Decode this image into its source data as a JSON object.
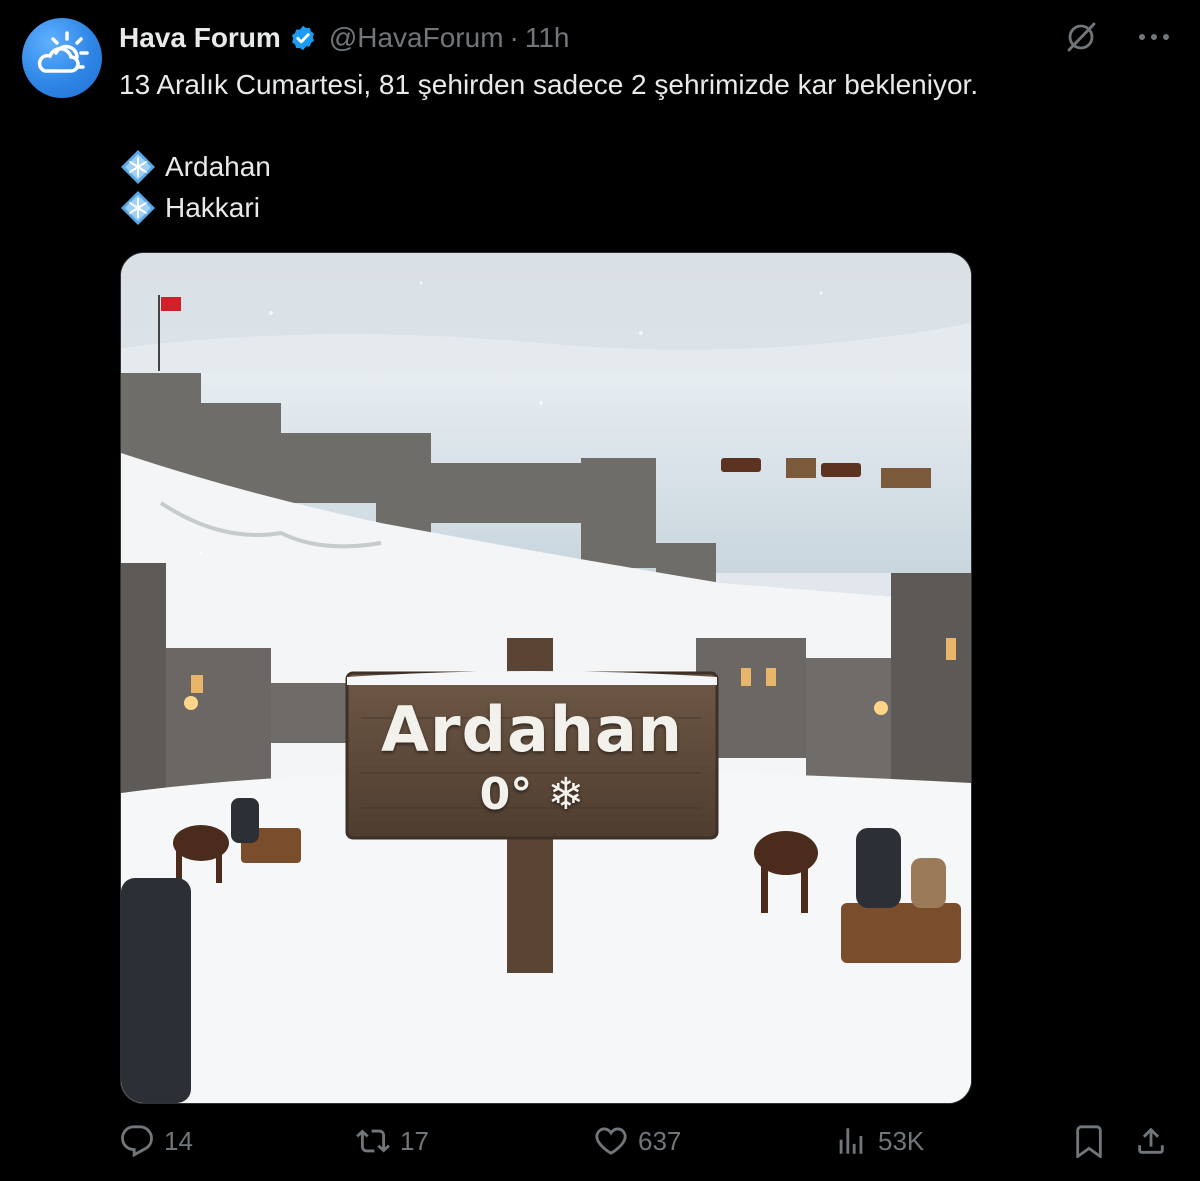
{
  "author": {
    "name": "Hava Forum",
    "handle": "@HavaForum",
    "time": "11h",
    "separator": "·",
    "avatar_icon": "cloud-sun-icon",
    "avatar_color": "#2f86e6",
    "verified": true
  },
  "tweet": {
    "line1": "13 Aralık Cumartesi, 81 şehirden sadece 2 şehrimizde kar bekleniyor.",
    "cities": [
      {
        "icon": "snowflake-diamond-icon",
        "name": "Ardahan"
      },
      {
        "icon": "snowflake-diamond-icon",
        "name": "Hakkari"
      }
    ]
  },
  "media": {
    "sign_city": "Ardahan",
    "sign_temp": "0° ❄"
  },
  "actions": {
    "replies": "14",
    "reposts": "17",
    "likes": "637",
    "views": "53K"
  },
  "colors": {
    "background": "#000000",
    "text": "#e7e9ea",
    "muted": "#71767b",
    "verified_badge": "#1d9bf0"
  }
}
